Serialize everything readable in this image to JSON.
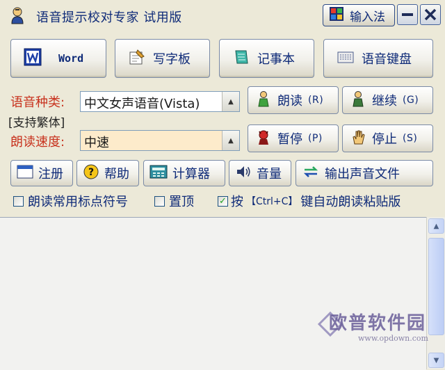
{
  "window": {
    "title": "语音提示校对专家 试用版",
    "ime_button_label": "输入法"
  },
  "toolbar": {
    "word_label": "Word",
    "wordpad_label": "写字板",
    "notepad_label": "记事本",
    "voice_keyboard_label": "语音键盘"
  },
  "voice": {
    "type_label": "语音种类:",
    "type_value": "中文女声语音(Vista)",
    "traditional_note": "[支持繁体]",
    "speed_label": "朗读速度:",
    "speed_value": "中速"
  },
  "controls": {
    "read_label": "朗读",
    "read_key": "(R)",
    "continue_label": "继续",
    "continue_key": "(G)",
    "pause_label": "暂停",
    "pause_key": "(P)",
    "stop_label": "停止",
    "stop_key": "(S)"
  },
  "actions": {
    "register_label": "注册",
    "help_label": "帮助",
    "calculator_label": "计算器",
    "volume_label": "音量",
    "export_label": "输出声音文件"
  },
  "options": {
    "read_punct_label": "朗读常用标点符号",
    "read_punct_checked": false,
    "topmost_label": "置顶",
    "topmost_checked": false,
    "ctrl_c_label_prefix": "按",
    "ctrl_c_key": "【Ctrl+C】",
    "ctrl_c_label_suffix": "键自动朗读粘贴版",
    "ctrl_c_checked": true
  },
  "watermark": {
    "title": "欧普软件园",
    "url": "www.opdown.com"
  }
}
